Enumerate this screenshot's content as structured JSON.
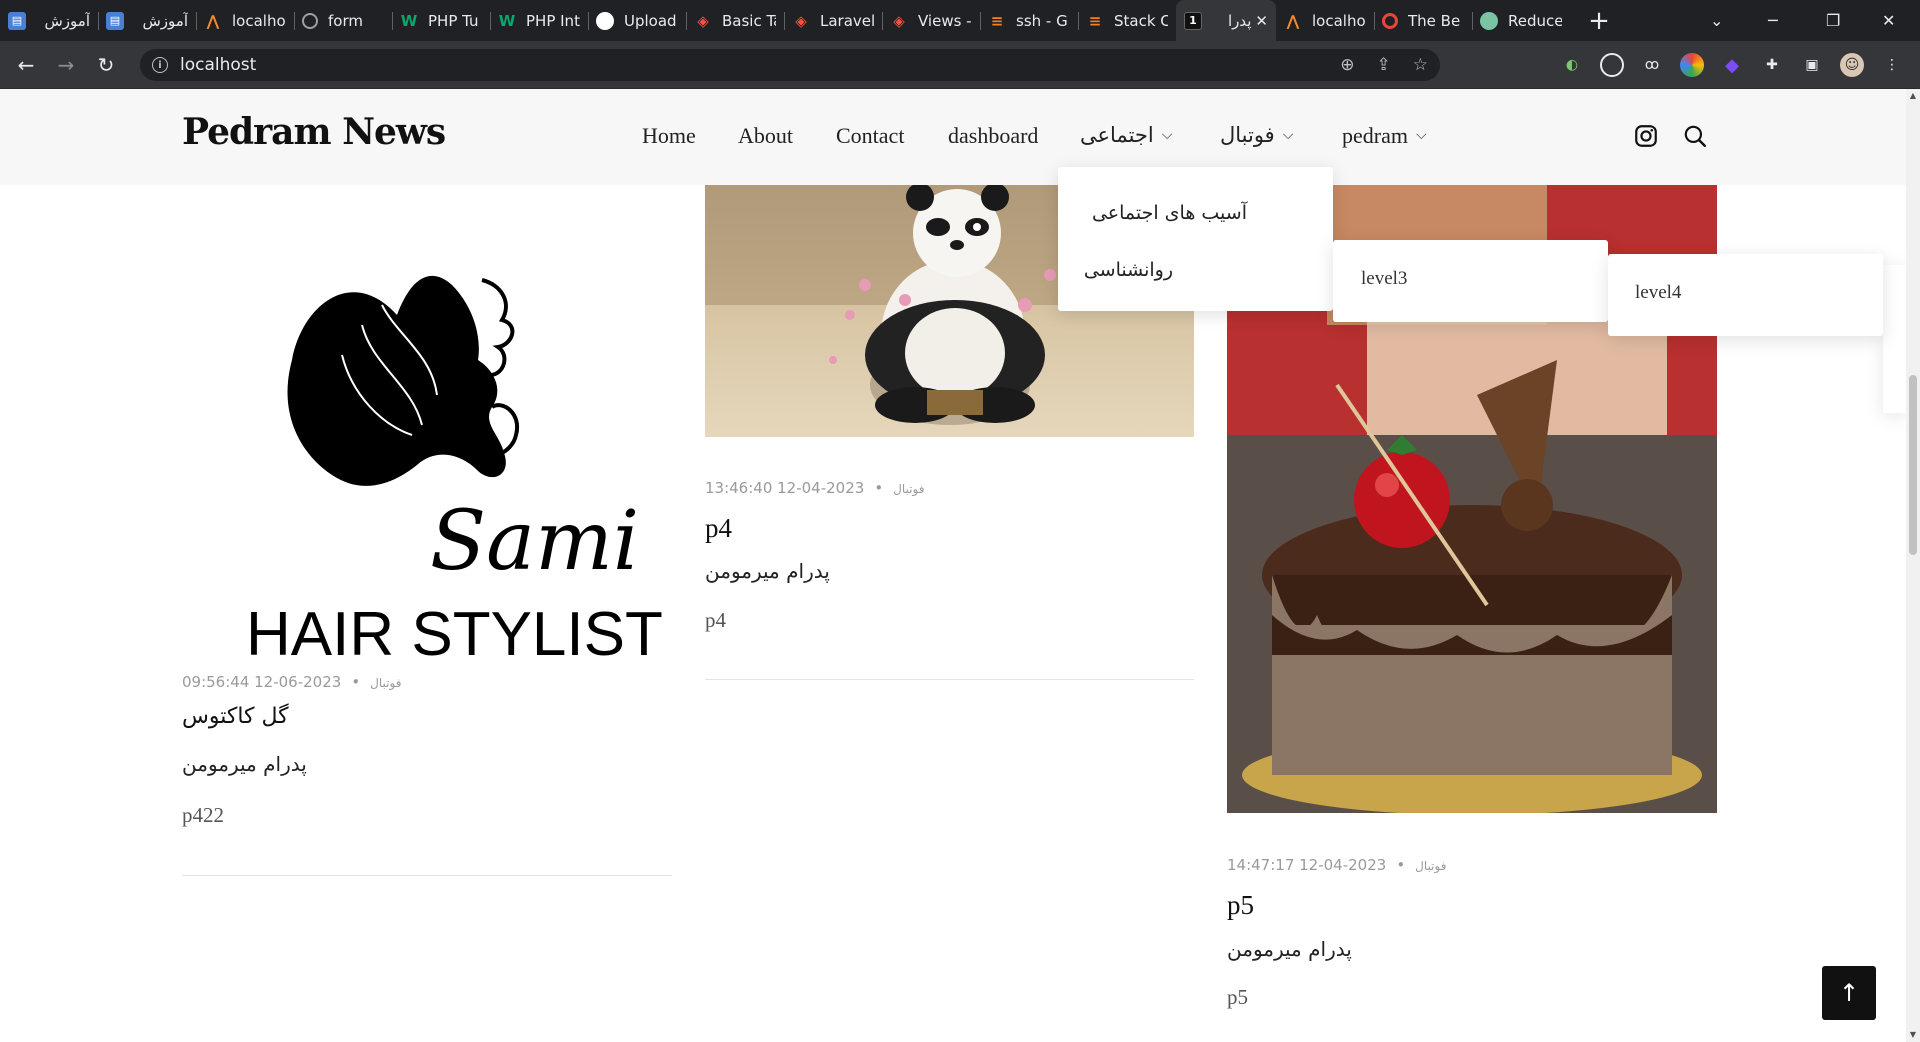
{
  "browser": {
    "tabs": [
      {
        "label": "آموزش",
        "icon": "blue-doc-icon",
        "color": "#4a7fd6"
      },
      {
        "label": "آموزش",
        "icon": "blue-doc-icon",
        "color": "#4a7fd6"
      },
      {
        "label": "localho",
        "icon": "xampp-icon",
        "color": "#f28b30"
      },
      {
        "label": "form",
        "icon": "globe-icon",
        "color": "#9aa0a6"
      },
      {
        "label": "PHP Tu",
        "icon": "w3schools-icon",
        "color": "#04aa6d"
      },
      {
        "label": "PHP Int",
        "icon": "w3schools-icon",
        "color": "#04aa6d"
      },
      {
        "label": "Upload",
        "icon": "github-icon",
        "color": "#ffffff"
      },
      {
        "label": "Basic Ta",
        "icon": "laravel-icon",
        "color": "#f05340"
      },
      {
        "label": "Laravel",
        "icon": "laravel-icon",
        "color": "#f05340"
      },
      {
        "label": "Views -",
        "icon": "laravel-icon",
        "color": "#f05340"
      },
      {
        "label": "ssh - G",
        "icon": "stackoverflow-icon",
        "color": "#f48024"
      },
      {
        "label": "Stack C",
        "icon": "stackoverflow-icon",
        "color": "#f48024"
      },
      {
        "label": "پدرا",
        "icon": "page-icon",
        "color": "#111111",
        "active": true
      },
      {
        "label": "localho",
        "icon": "xampp-icon",
        "color": "#f28b30"
      },
      {
        "label": "The Be",
        "icon": "target-icon",
        "color": "#e8453c"
      },
      {
        "label": "Reduce",
        "icon": "earth-icon",
        "color": "#7ac4a4"
      }
    ],
    "active_close": "✕",
    "new_tab": "+",
    "url": "localhost"
  },
  "site": {
    "brand": "Pedram News",
    "menu": {
      "home": "Home",
      "about": "About",
      "contact": "Contact",
      "dashboard": "dashboard",
      "social": "اجتماعی",
      "football": "فوتبال",
      "pedram": "pedram"
    },
    "dropdown": {
      "item1": "آسیب های اجتماعی",
      "item2": "روانشناسی",
      "level3": "level3",
      "level4": "level4"
    },
    "back_to_top": "↑"
  },
  "posts": [
    {
      "image_text_script": "Sami",
      "image_text_caption": "HAIR STYLIST",
      "date": "09:56:44 12-06-2023",
      "category": "فوتبال",
      "title": "گل کاکتوس",
      "author": "پدرام میرمومن",
      "body": "p422"
    },
    {
      "date": "13:46:40 12-04-2023",
      "category": "فوتبال",
      "title": "p4",
      "author": "پدرام میرمومن",
      "body": "p4"
    },
    {
      "date": "14:47:17 12-04-2023",
      "category": "فوتبال",
      "title": "p5",
      "author": "پدرام میرمومن",
      "body": "p5"
    }
  ]
}
